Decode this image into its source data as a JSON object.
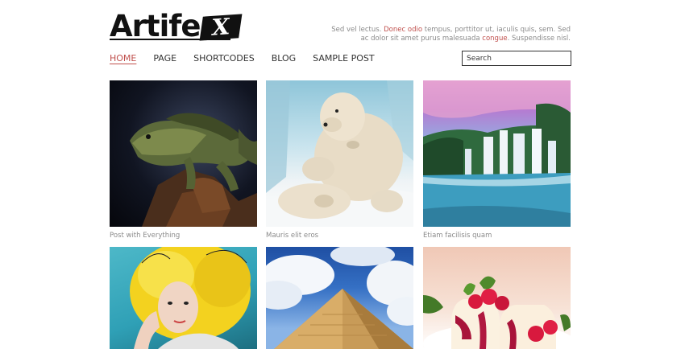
{
  "logo": {
    "text": "Artife",
    "x_glyph": "X"
  },
  "tagline": {
    "part1": "Sed vel lectus. ",
    "link1": "Donec odio",
    "part2": " tempus, porttitor ut, iaculis quis, sem. Sed ac dolor sit amet purus malesuada ",
    "link2": "congue",
    "part3": ". Suspendisse nisl."
  },
  "nav": {
    "items": [
      {
        "label": "HOME"
      },
      {
        "label": "PAGE"
      },
      {
        "label": "SHORTCODES"
      },
      {
        "label": "BLOG"
      },
      {
        "label": "SAMPLE POST"
      }
    ]
  },
  "search": {
    "placeholder": "Search"
  },
  "posts": [
    {
      "caption": "Post with Everything",
      "image": "iguana"
    },
    {
      "caption": "Mauris elit eros",
      "image": "polar-bear"
    },
    {
      "caption": "Etiam facilisis quam",
      "image": "waterfall"
    },
    {
      "caption": "",
      "image": "woman-yellow-hair"
    },
    {
      "caption": "",
      "image": "pyramid"
    },
    {
      "caption": "",
      "image": "raspberry-dessert"
    }
  ],
  "colors": {
    "accent": "#c0504d",
    "text": "#333333",
    "muted": "#8a8a8a"
  }
}
